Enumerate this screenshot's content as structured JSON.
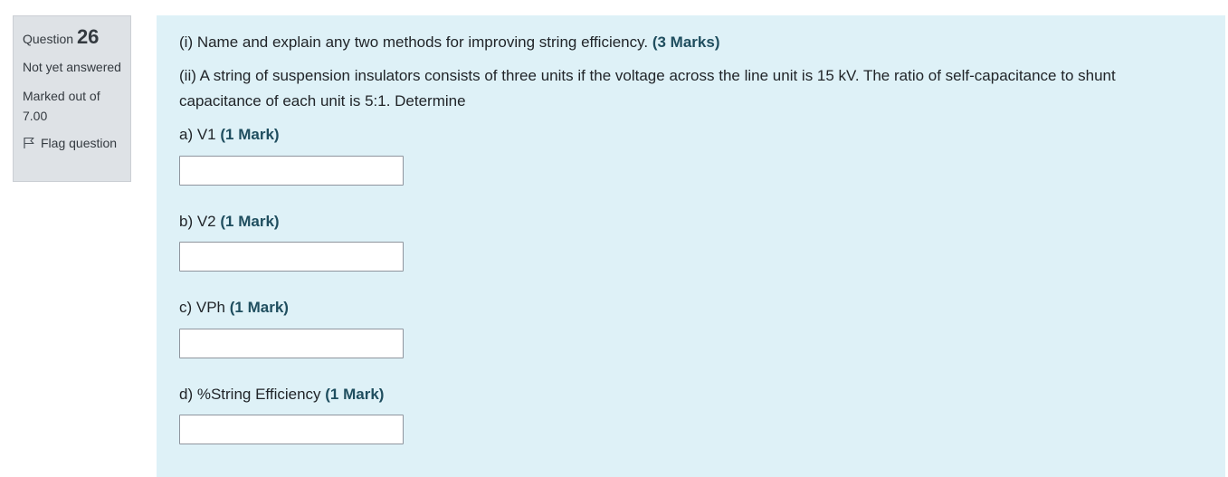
{
  "info": {
    "question_label": "Question",
    "question_number": "26",
    "state": "Not yet answered",
    "grade": "Marked out of 7.00",
    "flag_label": "Flag question"
  },
  "question": {
    "part1": "(i) Name and explain any two methods for improving string efficiency.",
    "part1_marks": "(3 Marks)",
    "part2": "(ii) A string of suspension insulators consists of three units if the voltage across the line unit is 15 kV. The ratio of self-capacitance to shunt capacitance of each unit is 5:1. Determine",
    "subparts": [
      {
        "label": "a) V1",
        "marks": "(1 Mark)",
        "value": ""
      },
      {
        "label": "b) V2",
        "marks": "(1 Mark)",
        "value": ""
      },
      {
        "label": "c) VPh",
        "marks": "(1 Mark)",
        "value": ""
      },
      {
        "label": "d) %String Efficiency",
        "marks": "(1 Mark)",
        "value": ""
      }
    ]
  },
  "colors": {
    "info_bg": "#dee2e6",
    "content_bg": "#def1f7",
    "marks_text": "#1f4e5f"
  }
}
